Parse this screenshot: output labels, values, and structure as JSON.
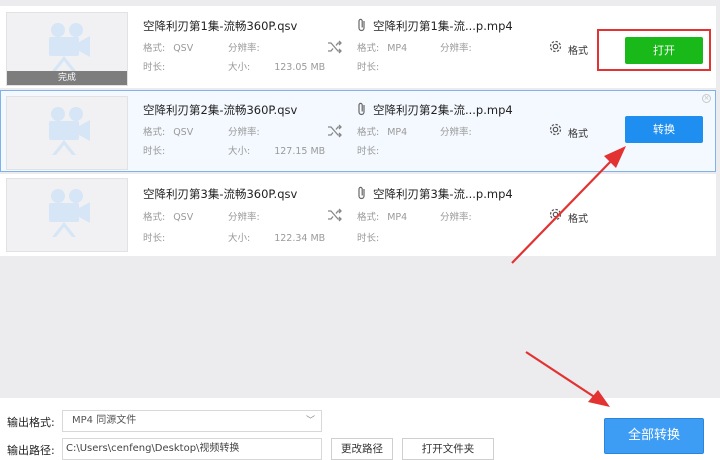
{
  "files": [
    {
      "source_name": "空降利刃第1集-流畅360P.qsv",
      "format_label": "格式:",
      "format_value": "QSV",
      "resolution_label": "分辨率:",
      "duration_label": "时长:",
      "size_label": "大小:",
      "size_value": "123.05 MB",
      "output_name": "空降利刃第1集-流...p.mp4",
      "out_format_label": "格式:",
      "out_format_value": "MP4",
      "out_resolution_label": "分辨率:",
      "out_duration_label": "时长:",
      "settings_label": "格式",
      "status_text": "完成",
      "action_label": "打开"
    },
    {
      "source_name": "空降利刃第2集-流畅360P.qsv",
      "format_label": "格式:",
      "format_value": "QSV",
      "resolution_label": "分辨率:",
      "duration_label": "时长:",
      "size_label": "大小:",
      "size_value": "127.15 MB",
      "output_name": "空降利刃第2集-流...p.mp4",
      "out_format_label": "格式:",
      "out_format_value": "MP4",
      "out_resolution_label": "分辨率:",
      "out_duration_label": "时长:",
      "settings_label": "格式",
      "action_label": "转换"
    },
    {
      "source_name": "空降利刃第3集-流畅360P.qsv",
      "format_label": "格式:",
      "format_value": "QSV",
      "resolution_label": "分辨率:",
      "duration_label": "时长:",
      "size_label": "大小:",
      "size_value": "122.34 MB",
      "output_name": "空降利刃第3集-流...p.mp4",
      "out_format_label": "格式:",
      "out_format_value": "MP4",
      "out_resolution_label": "分辨率:",
      "out_duration_label": "时长:",
      "settings_label": "格式"
    }
  ],
  "footer": {
    "output_format_label": "输出格式:",
    "output_format_value": "MP4  同源文件",
    "output_path_label": "输出路径:",
    "output_path_value": "C:\\Users\\cenfeng\\Desktop\\视频转换",
    "change_path_label": "更改路径",
    "open_folder_label": "打开文件夹",
    "convert_all_label": "全部转换"
  },
  "colors": {
    "open_button": "#19b919",
    "convert_button": "#1e8ef0",
    "convert_all_button": "#3d9cf3",
    "annotation_red": "#e23232",
    "selected_border": "#7fb2ea"
  },
  "icons": [
    "video-camera-icon",
    "shuffle-icon",
    "paperclip-icon",
    "gear-icon",
    "close-icon",
    "chevron-down-icon"
  ]
}
